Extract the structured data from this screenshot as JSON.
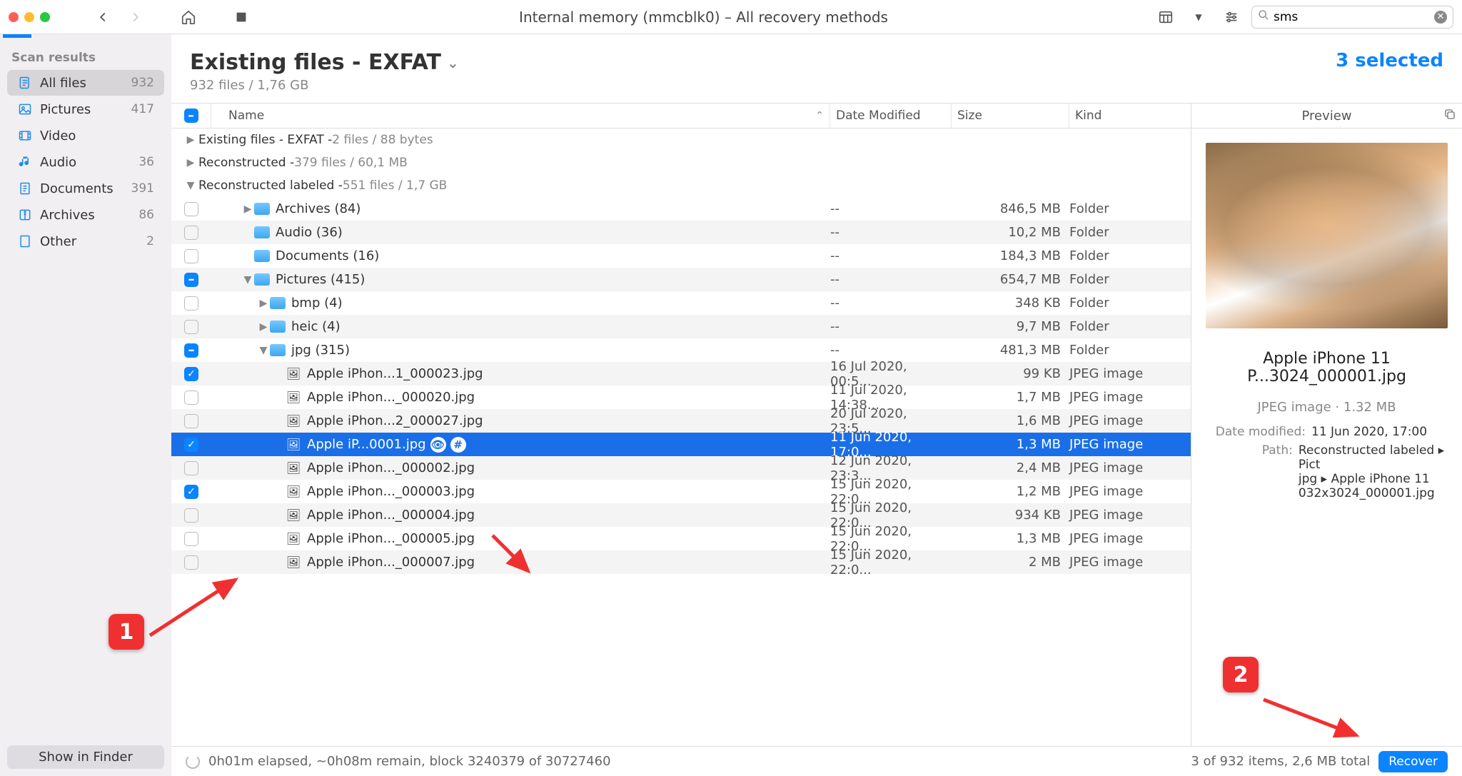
{
  "toolbar": {
    "title": "Internal memory (mmcblk0) – All recovery methods",
    "search": {
      "value": "sms"
    }
  },
  "sidebar": {
    "header": "Scan results",
    "items": [
      {
        "icon": "files",
        "label": "All files",
        "count": "932"
      },
      {
        "icon": "pictures",
        "label": "Pictures",
        "count": "417"
      },
      {
        "icon": "video",
        "label": "Video",
        "count": ""
      },
      {
        "icon": "audio",
        "label": "Audio",
        "count": "36"
      },
      {
        "icon": "documents",
        "label": "Documents",
        "count": "391"
      },
      {
        "icon": "archives",
        "label": "Archives",
        "count": "86"
      },
      {
        "icon": "other",
        "label": "Other",
        "count": "2"
      }
    ],
    "footer": "Show in Finder"
  },
  "header": {
    "title": "Existing files - EXFAT",
    "sub": "932 files / 1,76 GB",
    "selected": "3 selected"
  },
  "columns": {
    "name": "Name",
    "date": "Date Modified",
    "size": "Size",
    "kind": "Kind"
  },
  "groups": [
    {
      "disc": "▶",
      "label": "Existing files - EXFAT - ",
      "stats": "2 files / 88 bytes"
    },
    {
      "disc": "▶",
      "label": "Reconstructed - ",
      "stats": "379 files / 60,1 MB"
    },
    {
      "disc": "▼",
      "label": "Reconstructed labeled - ",
      "stats": "551 files / 1,7 GB"
    }
  ],
  "rows": [
    {
      "chk": "none",
      "indent": 1,
      "disc": "▶",
      "icon": "folder",
      "name": "Archives (84)",
      "date": "--",
      "size": "846,5 MB",
      "kind": "Folder"
    },
    {
      "chk": "none",
      "indent": 1,
      "disc": "",
      "icon": "folder",
      "name": "Audio (36)",
      "date": "--",
      "size": "10,2 MB",
      "kind": "Folder"
    },
    {
      "chk": "none",
      "indent": 1,
      "disc": "",
      "icon": "folder",
      "name": "Documents (16)",
      "date": "--",
      "size": "184,3 MB",
      "kind": "Folder"
    },
    {
      "chk": "mixed",
      "indent": 1,
      "disc": "▼",
      "icon": "folder",
      "name": "Pictures (415)",
      "date": "--",
      "size": "654,7 MB",
      "kind": "Folder"
    },
    {
      "chk": "none",
      "indent": 2,
      "disc": "▶",
      "icon": "folder",
      "name": "bmp (4)",
      "date": "--",
      "size": "348 KB",
      "kind": "Folder"
    },
    {
      "chk": "none",
      "indent": 2,
      "disc": "▶",
      "icon": "folder",
      "name": "heic (4)",
      "date": "--",
      "size": "9,7 MB",
      "kind": "Folder"
    },
    {
      "chk": "mixed",
      "indent": 2,
      "disc": "▼",
      "icon": "folder",
      "name": "jpg (315)",
      "date": "--",
      "size": "481,3 MB",
      "kind": "Folder"
    },
    {
      "chk": "checked",
      "indent": 3,
      "disc": "",
      "icon": "file",
      "name": "Apple iPhon...1_000023.jpg",
      "date": "16 Jul 2020, 00:5...",
      "size": "99 KB",
      "kind": "JPEG image"
    },
    {
      "chk": "none",
      "indent": 3,
      "disc": "",
      "icon": "file",
      "name": "Apple iPhon..._000020.jpg",
      "date": "11 Jul 2020, 14:38...",
      "size": "1,7 MB",
      "kind": "JPEG image"
    },
    {
      "chk": "none",
      "indent": 3,
      "disc": "",
      "icon": "file",
      "name": "Apple iPhon...2_000027.jpg",
      "date": "20 Jul 2020, 23:5...",
      "size": "1,6 MB",
      "kind": "JPEG image"
    },
    {
      "chk": "checked",
      "indent": 3,
      "disc": "",
      "icon": "file",
      "name": "Apple iP...0001.jpg",
      "date": "11 Jun 2020, 17:0...",
      "size": "1,3 MB",
      "kind": "JPEG image",
      "selected": true,
      "badges": true
    },
    {
      "chk": "none",
      "indent": 3,
      "disc": "",
      "icon": "file",
      "name": "Apple iPhon..._000002.jpg",
      "date": "12 Jun 2020, 23:3...",
      "size": "2,4 MB",
      "kind": "JPEG image"
    },
    {
      "chk": "checked",
      "indent": 3,
      "disc": "",
      "icon": "file",
      "name": "Apple iPhon..._000003.jpg",
      "date": "15 Jun 2020, 22:0...",
      "size": "1,2 MB",
      "kind": "JPEG image"
    },
    {
      "chk": "none",
      "indent": 3,
      "disc": "",
      "icon": "file",
      "name": "Apple iPhon..._000004.jpg",
      "date": "15 Jun 2020, 22:0...",
      "size": "934 KB",
      "kind": "JPEG image"
    },
    {
      "chk": "none",
      "indent": 3,
      "disc": "",
      "icon": "file",
      "name": "Apple iPhon..._000005.jpg",
      "date": "15 Jun 2020, 22:0...",
      "size": "1,3 MB",
      "kind": "JPEG image"
    },
    {
      "chk": "none",
      "indent": 3,
      "disc": "",
      "icon": "file",
      "name": "Apple iPhon..._000007.jpg",
      "date": "15 Jun 2020, 22:0...",
      "size": "2 MB",
      "kind": "JPEG image"
    }
  ],
  "preview": {
    "header": "Preview",
    "name": "Apple iPhone 11 P...3024_000001.jpg",
    "kind_size": "JPEG image · 1.32 MB",
    "date_k": "Date modified:",
    "date_v": "11 Jun 2020, 17:00",
    "path_k": "Path:",
    "path_lines": [
      "Reconstructed labeled ▸ Pict",
      "jpg ▸ Apple iPhone 11",
      "032x3024_000001.jpg"
    ]
  },
  "status": {
    "left": "0h01m elapsed, ~0h08m remain, block 3240379 of 30727460",
    "right": "3 of 932 items, 2,6 MB total",
    "btn": "Recover"
  },
  "callouts": {
    "c1": "1",
    "c2": "2"
  }
}
